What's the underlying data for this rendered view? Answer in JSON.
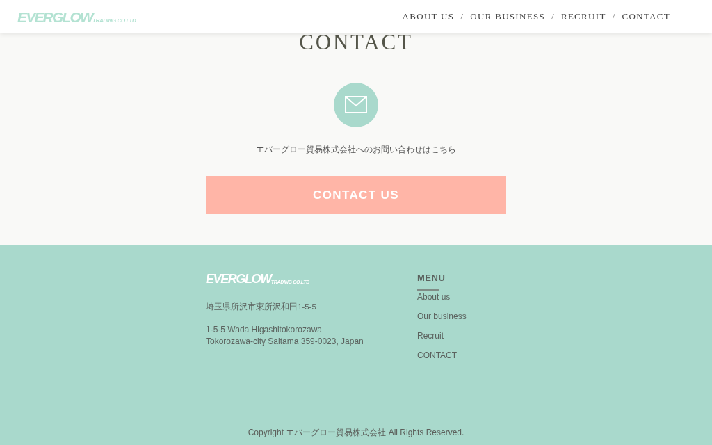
{
  "header": {
    "logo": {
      "name": "EVERGLOW",
      "suffix": "TRADING CO.LTD"
    },
    "nav": [
      {
        "label": "ABOUT US",
        "separator": "/"
      },
      {
        "label": "OUR BUSINESS",
        "separator": "/"
      },
      {
        "label": "RECRUIT",
        "separator": "/"
      },
      {
        "label": "CONTACT"
      }
    ]
  },
  "contact": {
    "title": "CONTACT",
    "message": "エバーグロー貿易株式会社へのお問い合わせはこちら",
    "button": "CONTACT US"
  },
  "footer": {
    "logo": {
      "name": "EVERGLOW",
      "suffix": "TRADING CO.LTD"
    },
    "address_ja": "埼玉県所沢市東所沢和田1-5-5",
    "address_en": [
      "1-5-5 Wada Higashitokorozawa",
      "Tokorozawa-city Saitama 359-0023, Japan"
    ],
    "menu": {
      "title": "MENU",
      "items": [
        "About us",
        "Our business",
        "Recruit",
        "CONTACT"
      ]
    },
    "copyright": "Copyright エバーグロー貿易株式会社 All Rights Reserved."
  }
}
